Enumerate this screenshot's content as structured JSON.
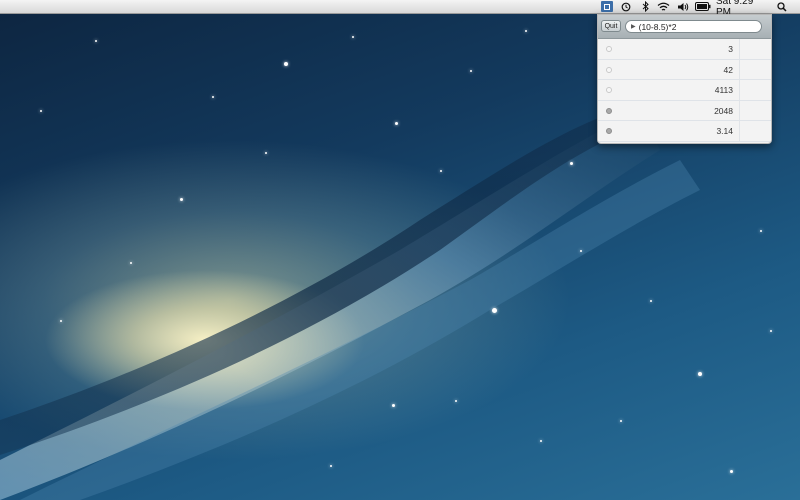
{
  "menubar": {
    "clock": "Sat 9:29 PM",
    "icons": [
      "calculator-app-icon",
      "time-machine-icon",
      "bluetooth-icon",
      "wifi-icon",
      "volume-icon",
      "battery-icon",
      "spotlight-search-icon"
    ]
  },
  "popup": {
    "quit_label": "Quit",
    "expression_value": "(10-8.5)*2",
    "results": [
      {
        "value": "3",
        "marked": false
      },
      {
        "value": "42",
        "marked": false
      },
      {
        "value": "4113",
        "marked": false
      },
      {
        "value": "2048",
        "marked": true
      },
      {
        "value": "3.14",
        "marked": true
      }
    ]
  },
  "colors": {
    "menubar": "#e6e6e6",
    "popup_toolbar": "#b4bcc0",
    "desktop_deep": "#0d2540",
    "desktop_light": "#2a6f98"
  }
}
